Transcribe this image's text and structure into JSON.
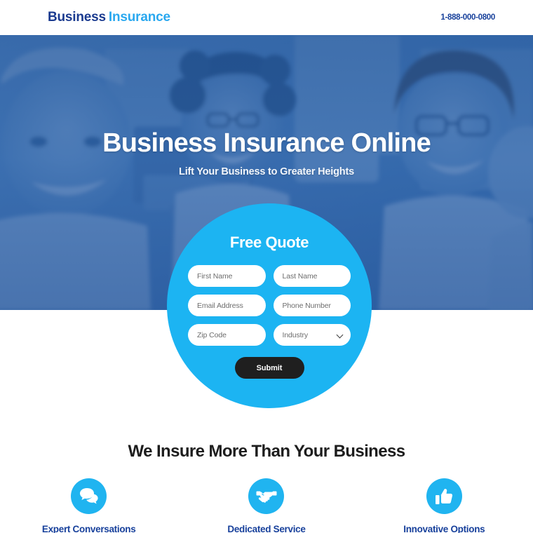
{
  "header": {
    "logo_primary": "Business",
    "logo_secondary": "Insurance",
    "phone": "1-888-000-0800",
    "brand_navy": "#1a3a8f",
    "brand_cyan": "#2aa8ef"
  },
  "hero": {
    "title": "Business Insurance Online",
    "subtitle": "Lift Your Business to Greater Heights",
    "overlay_color": "#2a63a8"
  },
  "quote_form": {
    "title": "Free Quote",
    "circle_color": "#1cb4f2",
    "fields": [
      {
        "name": "first-name",
        "placeholder": "First Name",
        "value": "",
        "type": "text"
      },
      {
        "name": "last-name",
        "placeholder": "Last Name",
        "value": "",
        "type": "text"
      },
      {
        "name": "email-address",
        "placeholder": "Email Address",
        "value": "",
        "type": "email"
      },
      {
        "name": "phone-number",
        "placeholder": "Phone Number",
        "value": "",
        "type": "tel"
      },
      {
        "name": "zip-code",
        "placeholder": "Zip Code",
        "value": "",
        "type": "text"
      },
      {
        "name": "industry",
        "placeholder": "Industry",
        "value": "Industry",
        "type": "select"
      }
    ],
    "submit_label": "Submit",
    "submit_color": "#1f1f1f"
  },
  "features": {
    "title": "We Insure More Than Your Business",
    "icon_color": "#20b4f0",
    "label_color": "#17409b",
    "items": [
      {
        "icon": "speech-bubbles-icon",
        "label": "Expert Conversations"
      },
      {
        "icon": "handshake-icon",
        "label": "Dedicated Service"
      },
      {
        "icon": "thumbs-up-icon",
        "label": "Innovative Options"
      }
    ]
  }
}
